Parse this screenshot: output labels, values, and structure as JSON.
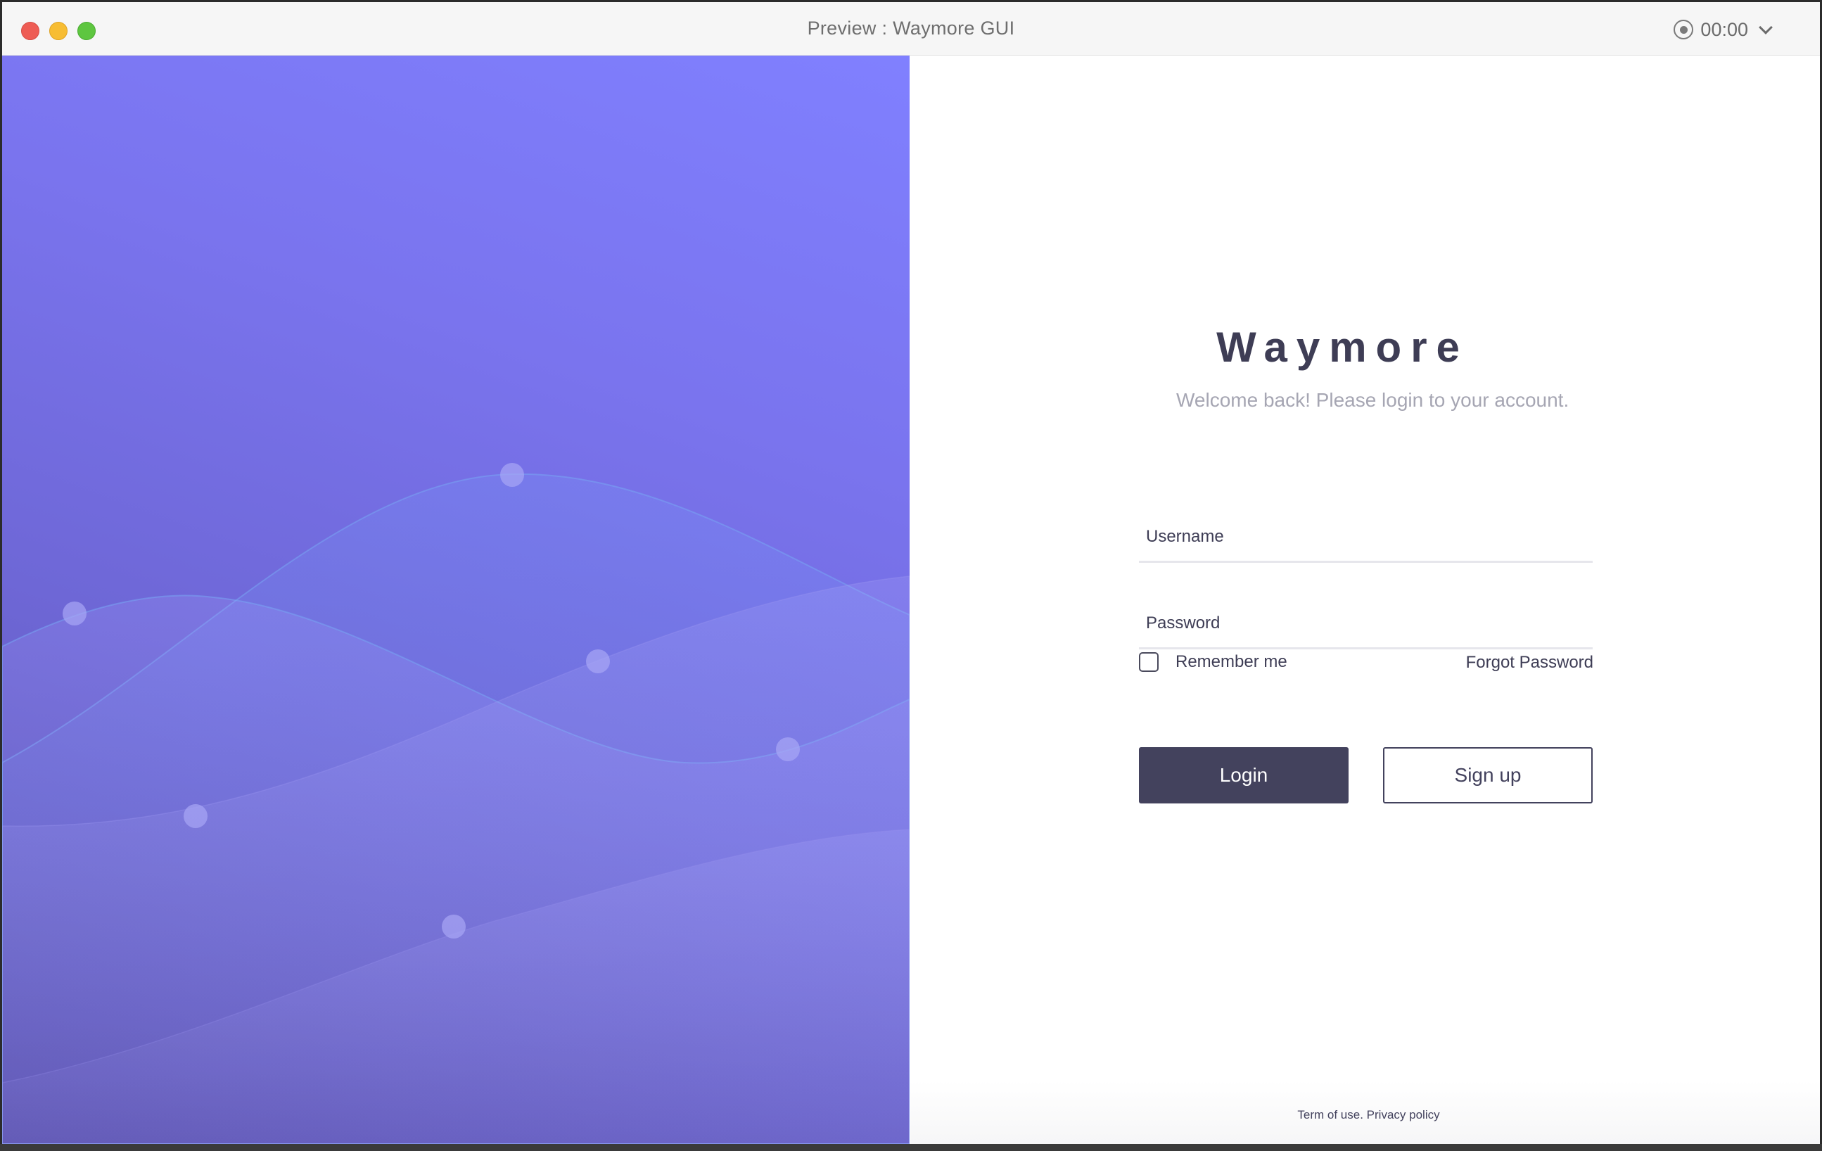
{
  "window": {
    "title": "Preview : Waymore GUI",
    "recording_time": "00:00"
  },
  "login": {
    "brand": "Waymore",
    "welcome": "Welcome back! Please login to your account.",
    "username_placeholder": "Username",
    "password_placeholder": "Password",
    "remember_label": "Remember me",
    "remember_checked": false,
    "forgot_label": "Forgot Password",
    "login_label": "Login",
    "signup_label": "Sign up"
  },
  "footer": {
    "terms": "Term of use.",
    "privacy": "Privacy policy"
  },
  "colors": {
    "hero_top": "#8080ff",
    "hero_bottom": "#5a50ad",
    "primary": "#43425d"
  }
}
